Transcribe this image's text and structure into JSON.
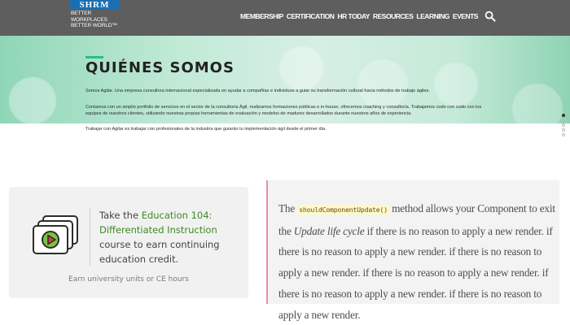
{
  "header": {
    "logo": {
      "mark": "SHRM",
      "tagline": "BETTER WORKPLACES\nBETTER WORLD™"
    },
    "nav": [
      {
        "label": "MEMBERSHIP"
      },
      {
        "label": "CERTIFICATION"
      },
      {
        "label": "HR TODAY"
      },
      {
        "label": "RESOURCES"
      },
      {
        "label": "LEARNING"
      },
      {
        "label": "EVENTS"
      }
    ],
    "search_icon": "search-icon"
  },
  "hero": {
    "title": "QUIÉNES SOMOS",
    "p1": "Somos Agilar. Una empresa consultora internacional especializada en ayudar a compañías e individuos a guiar su transformación cultural hacia métodos de trabajo ágiles.",
    "p2": "Contamos con un amplio portfolio de servicios en el sector de la consultoría Ágil, realizamos formaciones públicas e in-house, ofrecemos coaching y consultoría. Trabajamos codo con codo con los equipos de nuestros clientes, utilizando nuestras propias herramientas de evaluación y modelos de madurez desarrollados durante nuestros años de experiencia.",
    "p3": "Trabajar con Agilar es trabajar con profesionales de la industria que guiarán tu implementación ágil desde el primer día.",
    "pager_count": 6,
    "pager_active": 1
  },
  "education": {
    "pre": "Take the ",
    "highlight": "Education 104: Differentiated Instruction",
    "post": " course to earn continuing education credit.",
    "footer": "Earn university units or CE hours",
    "icon": "video-cards-icon",
    "highlight_color": "#3d8a25"
  },
  "note": {
    "t1": "The ",
    "code": "shouldComponentUpdate()",
    "t2": " method allows your Component to exit the ",
    "em": "Update life cycle",
    "t3": " if there is no reason to apply a new render. if there is no reason to apply a new render. if there is no reason to apply a new render. if there is no reason to apply a new render. if there is no reason to apply a new render. if there is no reason to apply a new render.",
    "border_color": "#e98ab1"
  }
}
